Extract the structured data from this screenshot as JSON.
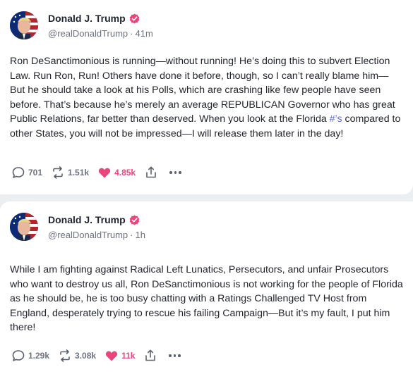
{
  "posts": [
    {
      "author": {
        "display_name": "Donald J. Trump",
        "handle": "@realDonaldTrump",
        "verified_icon": "verified-badge-icon"
      },
      "time": "41m",
      "text_before": "Ron DeSanctimonious is running—without running! He’s doing this to subvert Election Law. Run Ron, Run! Others have done it before, though, so I can’t really blame him—But he should take a look at his Polls, which are crashing like few people have seen before. That’s because he’s merely an average REPUBLICAN Governor who has great Public Relations, far better than deserved. When you look at the Florida ",
      "hashtag": "#’s",
      "text_after": " compared to other States, you will not be impressed—I will release them later in the day!",
      "replies": "701",
      "retruths": "1.51k",
      "likes": "4.85k"
    },
    {
      "author": {
        "display_name": "Donald J. Trump",
        "handle": "@realDonaldTrump",
        "verified_icon": "verified-badge-icon"
      },
      "time": "1h",
      "text_before": "While I am fighting against Radical Left Lunatics, Persecutors, and unfair Prosecutors who want to destroy us all, Ron DeSanctimonious is not working for the people of Florida as he should be, he is too busy chatting with a Ratings Challenged TV Host from England, desperately trying to rescue his failing Campaign—But it’s my fault, I put him there!",
      "hashtag": "",
      "text_after": "",
      "replies": "1.29k",
      "retruths": "3.08k",
      "likes": "11k"
    }
  ],
  "colors": {
    "accent": "#e9477b",
    "link": "#5b6bd6",
    "verified": "#e9477b",
    "muted": "#6b7280"
  }
}
